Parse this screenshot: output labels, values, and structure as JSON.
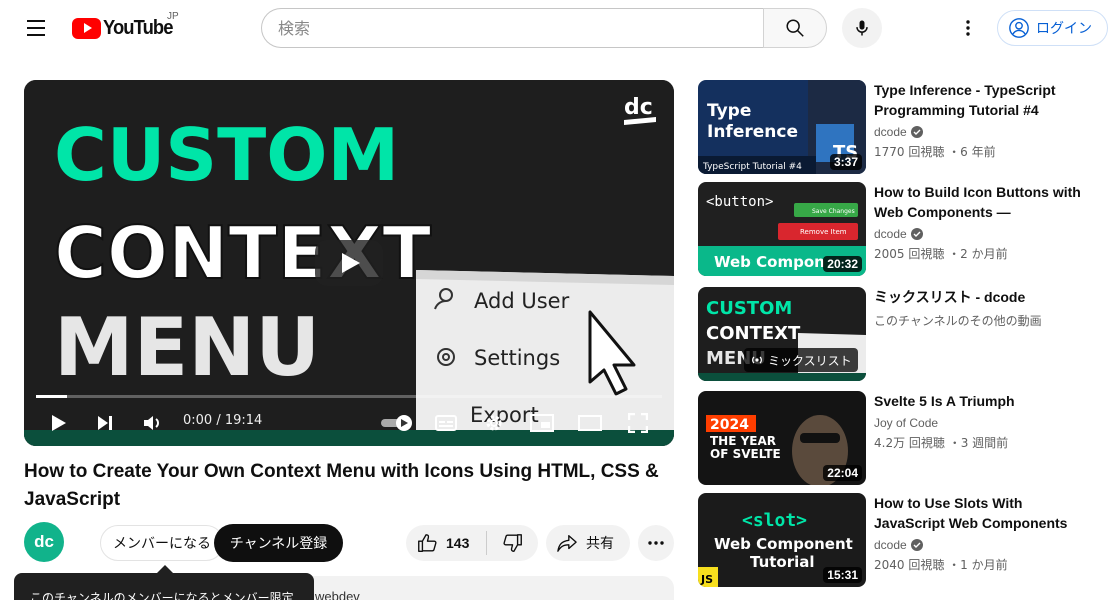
{
  "masthead": {
    "logo_text": "YouTube",
    "region": "JP",
    "search_placeholder": "検索",
    "signin_label": "ログイン"
  },
  "player": {
    "thumbnail_lines": [
      "CUSTOM",
      "CONTEXT",
      "MENU"
    ],
    "menu_items": [
      "Add User",
      "Settings",
      "Export"
    ],
    "channel_mark": "dc",
    "time": "0:00 / 19:14",
    "progress": 0.05
  },
  "video": {
    "title": "How to Create Your Own Context Menu with Icons Using HTML, CSS & JavaScript",
    "channel_avatar": "dc",
    "member_label": "メンバーになる",
    "subscribe_label": "チャンネル登録",
    "like_count": "143",
    "share_label": "共有",
    "tooltip": "このチャンネルのメンバーになるとメンバー限定",
    "description_peek": "webdev"
  },
  "recommendations": [
    {
      "title": "Type Inference - TypeScript Programming Tutorial #4",
      "channel": "dcode",
      "verified": true,
      "meta": "1770 回視聴 ・6 年前",
      "duration": "3:37",
      "thumb_text": [
        "Type",
        "Inference"
      ],
      "thumb_caption": "TypeScript Tutorial #4",
      "badge": "TS"
    },
    {
      "title": "How to Build Icon Buttons with Web Components — JavaScrip…",
      "channel": "dcode",
      "verified": true,
      "meta": "2005 回視聴 ・2 か月前",
      "duration": "20:32",
      "thumb_text": [
        "<button>",
        "Web Compon"
      ],
      "thumb_buttons": [
        "Save Changes",
        "Remove Item"
      ]
    },
    {
      "title": "ミックスリスト - dcode",
      "channel": "",
      "verified": false,
      "meta": "このチャンネルのその他の動画",
      "duration": "",
      "thumb_text": [
        "CUSTOM",
        "CONTEXT",
        "MENU"
      ],
      "mix_label": "ミックスリスト"
    },
    {
      "title": "Svelte 5 Is A Triumph",
      "channel": "Joy of Code",
      "verified": false,
      "meta": "4.2万 回視聴 ・3 週間前",
      "duration": "22:04",
      "thumb_text": [
        "2024",
        "THE YEAR",
        "OF SVELTE"
      ]
    },
    {
      "title": "How to Use Slots With JavaScript Web Components",
      "channel": "dcode",
      "verified": true,
      "meta": "2040 回視聴 ・1 か月前",
      "duration": "15:31",
      "thumb_text": [
        "<slot>",
        "Web Component",
        "Tutorial",
        "JS"
      ]
    }
  ]
}
